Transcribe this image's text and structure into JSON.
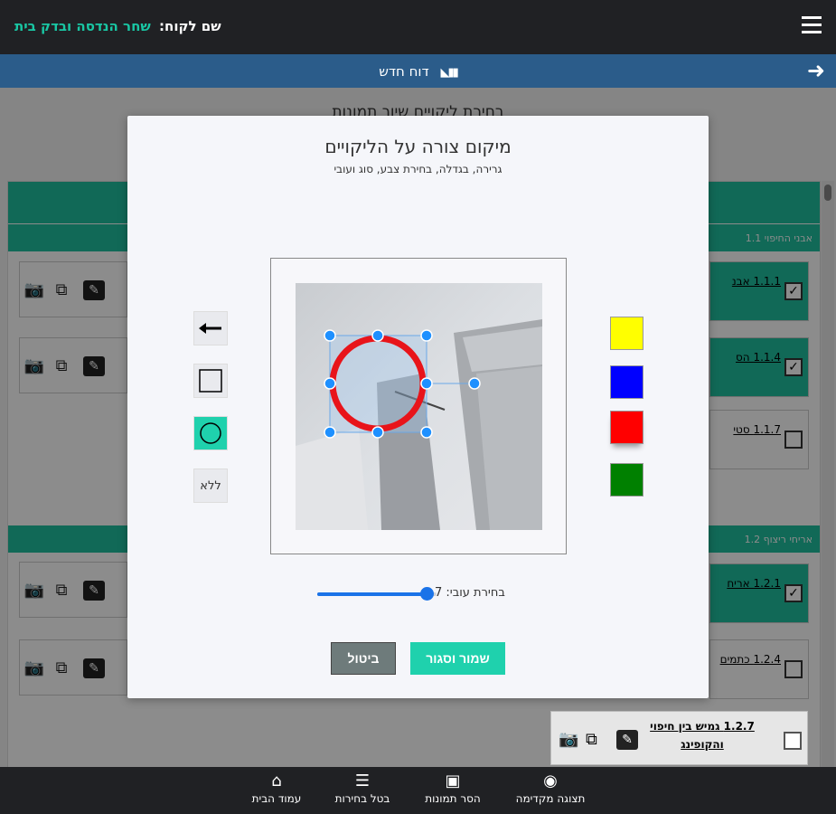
{
  "topbar": {
    "client_label": "שם לקוח:",
    "client_name": "שחר הנדסה ובדק בית"
  },
  "subbar": {
    "title": "דוח חדש",
    "back_icon": "arrow-right-icon",
    "book_icon": "books-icon"
  },
  "background": {
    "heading": "בחירת ליקויים שיוך תמונות",
    "sections": [
      {
        "label": "אבני החיפוי 1.1"
      },
      {
        "label": "אריחי ריצוף 1.2"
      }
    ],
    "items": [
      {
        "label": "1.1.1 אבנ",
        "checked": true
      },
      {
        "label": "1.1.4 הס",
        "checked": true
      },
      {
        "label": "1.1.7 סטי",
        "checked": false
      },
      {
        "label": "1.2.1 אריח",
        "checked": true
      },
      {
        "label": "1.2.4 כתמים",
        "checked": false
      },
      {
        "label": "1.2.7 גמיש בין חיפוי והקופינג",
        "checked": false
      }
    ]
  },
  "modal": {
    "title": "מיקום צורה על הליקויים",
    "subtitle": "גרירה, בגדלה, בחירת צבע, סוג ועובי",
    "shapes": [
      {
        "id": "arrow",
        "icon": "arrow-left-icon",
        "active": false
      },
      {
        "id": "square",
        "icon": "square-icon",
        "active": false
      },
      {
        "id": "circle",
        "icon": "circle-icon",
        "active": true
      },
      {
        "id": "none",
        "label": "ללא",
        "active": false
      }
    ],
    "colors": [
      "#ffff00",
      "#0000ff",
      "#ff0000",
      "#008000"
    ],
    "selected_color": "#ff0000",
    "thickness_label": "בחירת עובי:",
    "thickness_value": "7",
    "thickness_fraction": 0.92,
    "save_label": "שמור וסגור",
    "cancel_label": "ביטול"
  },
  "bottombar": {
    "items": [
      {
        "label": "תצוגה מקדימה",
        "icon": "eye-icon"
      },
      {
        "label": "הסר תמונות",
        "icon": "images-icon"
      },
      {
        "label": "בטל בחירות",
        "icon": "list-clear-icon"
      },
      {
        "label": "עמוד הבית",
        "icon": "home-icon"
      }
    ]
  },
  "colors": {
    "accent": "#1fd1ad",
    "topbar": "#202124",
    "subbar": "#2b5c8a",
    "handle": "#1e90ff"
  }
}
